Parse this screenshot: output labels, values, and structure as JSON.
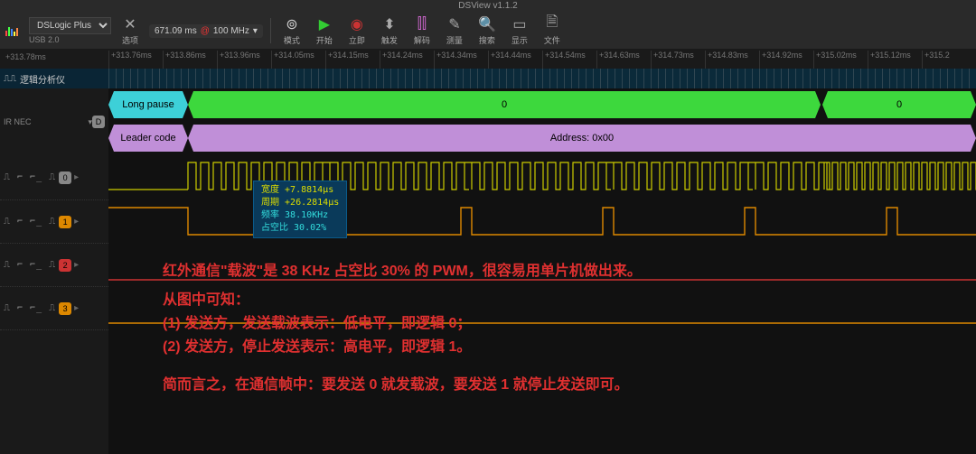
{
  "app": {
    "title": "DSView v1.1.2"
  },
  "toolbar": {
    "device": "DSLogic Plus",
    "usb": "USB 2.0",
    "options": "选项",
    "rate_val": "671.09 ms",
    "rate_at": "@",
    "rate_freq": "100 MHz",
    "btns": [
      {
        "icon": "⚙",
        "label": "模式",
        "color": "#ccc"
      },
      {
        "icon": "▶",
        "label": "开始",
        "color": "#3c3"
      },
      {
        "icon": "⏺",
        "label": "立即",
        "color": "#c33"
      },
      {
        "icon": "⬍",
        "label": "触发",
        "color": "#ccc"
      },
      {
        "icon": "⫿⫿",
        "label": "解码",
        "color": "#c6c"
      },
      {
        "icon": "✎",
        "label": "测量",
        "color": "#ccc"
      },
      {
        "icon": "🔍",
        "label": "搜索",
        "color": "#ccc"
      },
      {
        "icon": "▭",
        "label": "显示",
        "color": "#ccc"
      },
      {
        "icon": "🗎",
        "label": "文件",
        "color": "#ccc"
      }
    ]
  },
  "ruler": {
    "start": "+313.78ms",
    "ticks": [
      "+313.76ms",
      "+313.86ms",
      "+313.96ms",
      "+314.05ms",
      "+314.15ms",
      "+314.24ms",
      "+314.34ms",
      "+314.44ms",
      "+314.54ms",
      "+314.63ms",
      "+314.73ms",
      "+314.83ms",
      "+314.92ms",
      "+315.02ms",
      "+315.12ms",
      "+315.2"
    ]
  },
  "left": {
    "analyzer": "逻辑分析仪",
    "irnec": "IR NEC",
    "edge_pattern": "⎍ ⌐ ⌐_ ⎍",
    "ch": [
      {
        "idx": "0",
        "bg": "#888"
      },
      {
        "idx": "1",
        "bg": "#d80"
      },
      {
        "idx": "2",
        "bg": "#c33"
      },
      {
        "idx": "3",
        "bg": "#d80"
      }
    ]
  },
  "decode": {
    "row1": {
      "long_pause": "Long pause",
      "zero_a": "0",
      "zero_b": "0"
    },
    "row2": {
      "leader": "Leader code",
      "address": "Address: 0x00"
    }
  },
  "tooltip": {
    "l1_k": "宽度",
    "l1_v": "+7.8814μs",
    "l2_k": "周期",
    "l2_v": "+26.2814μs",
    "l3_k": "频率",
    "l3_v": "38.10KHz",
    "l4_k": "占空比",
    "l4_v": "30.02%"
  },
  "annot": {
    "l1": "红外通信\"载波\"是 38 KHz 占空比 30% 的 PWM，很容易用单片机做出来。",
    "l2": "从图中可知：",
    "l3": "(1) 发送方，发送载波表示：低电平，即逻辑 0；",
    "l4": "(2) 发送方，停止发送表示：高电平，即逻辑 1。",
    "l5": "简而言之，在通信帧中：要发送 0 就发载波，要发送 1 就停止发送即可。"
  }
}
